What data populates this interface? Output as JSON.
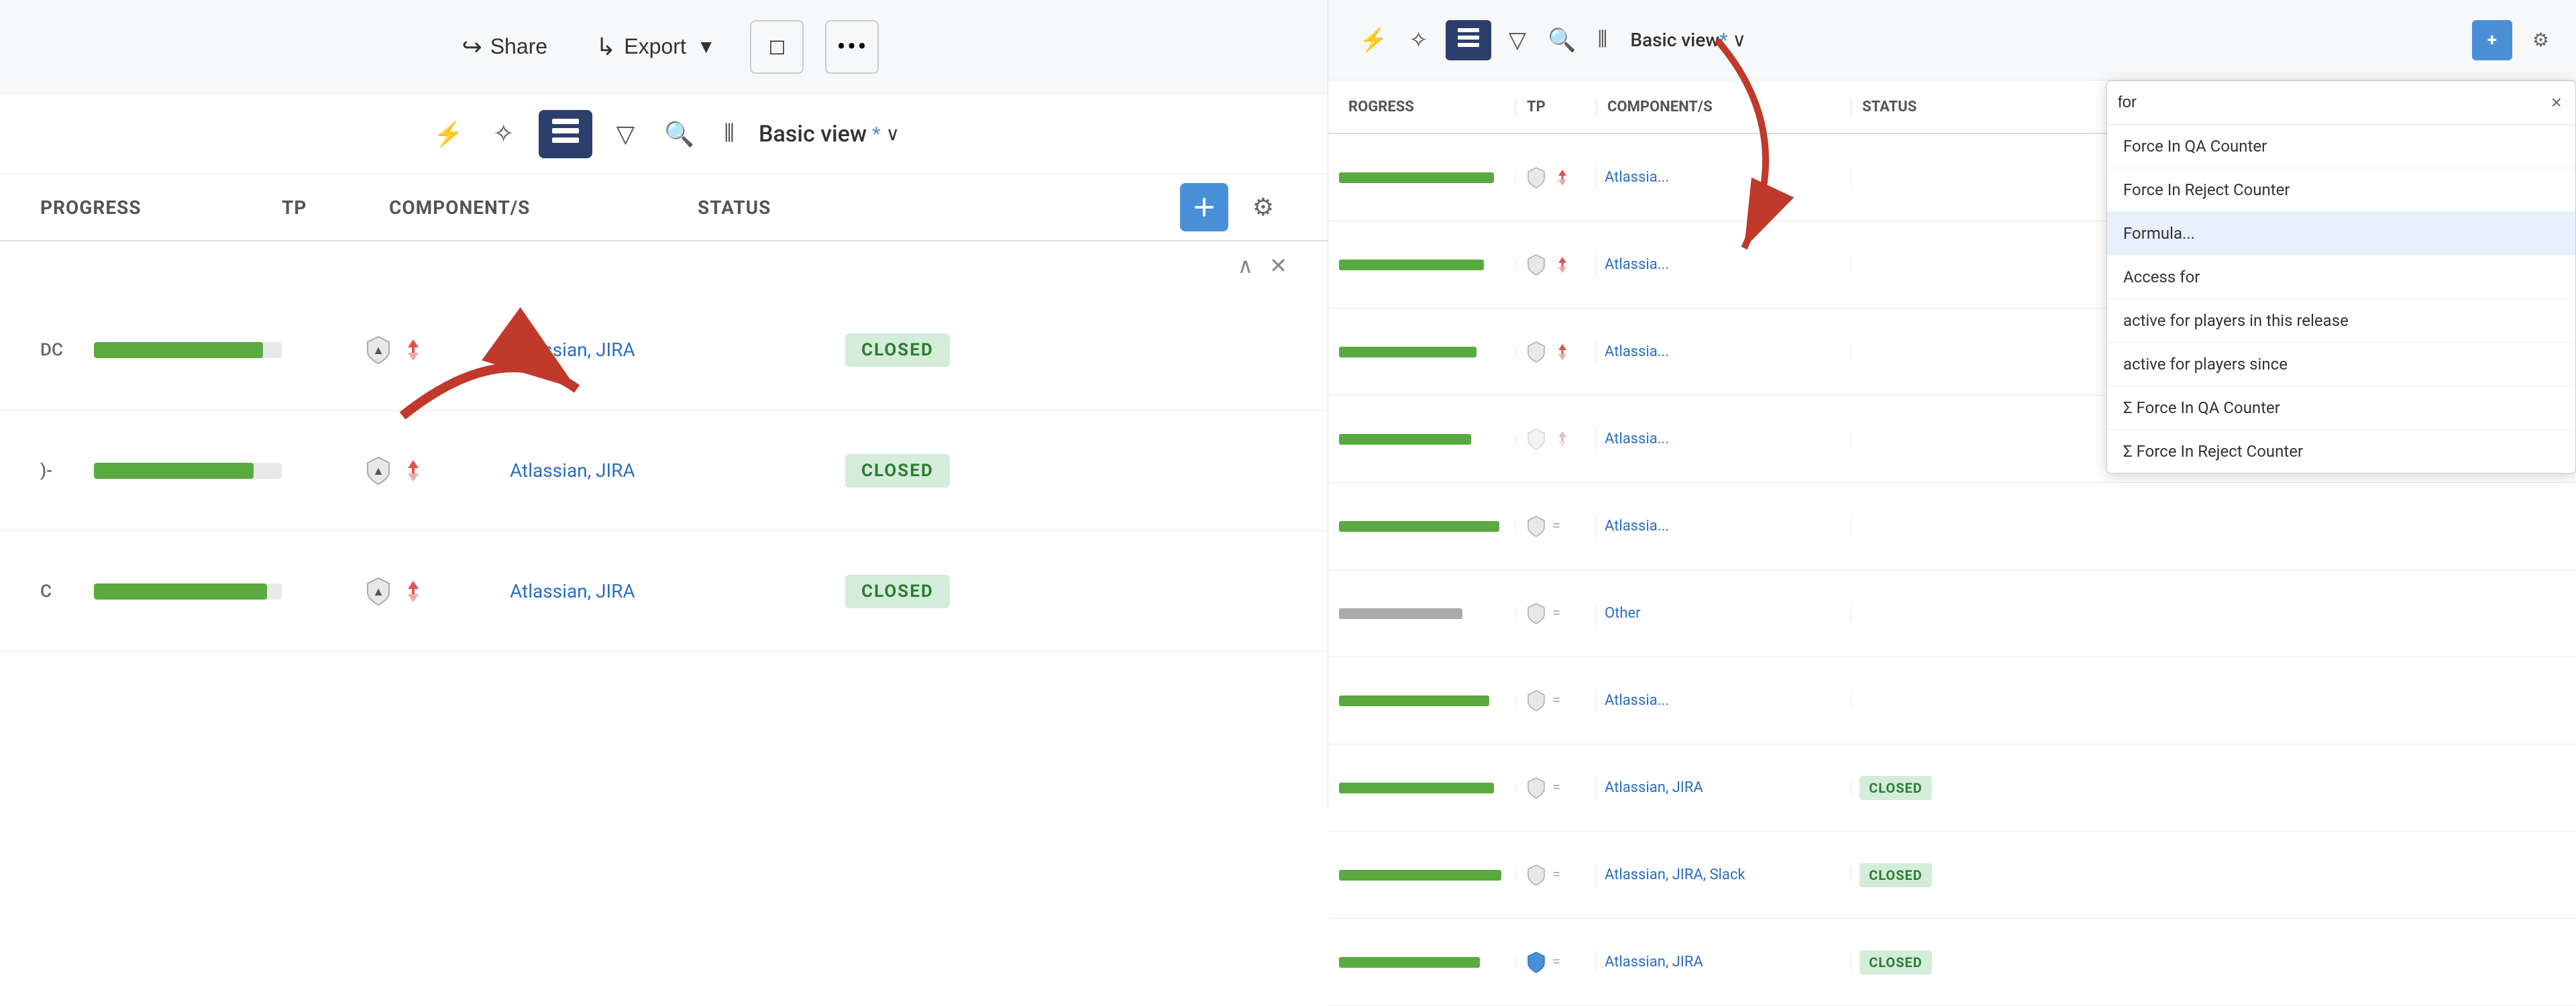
{
  "leftPanel": {
    "toolbar": {
      "shareLabel": "Share",
      "exportLabel": "Export",
      "shareIcon": "↪",
      "exportIcon": "↳"
    },
    "secondToolbar": {
      "lightningIcon": "⚡",
      "starIcon": "✧",
      "layersIcon": "≡",
      "filterIcon": "▽",
      "searchIcon": "⊙",
      "barsIcon": "|||",
      "basicViewLabel": "Basic view",
      "asterisk": "*",
      "chevronDown": "∨"
    },
    "columns": {
      "progress": "Progress",
      "tp": "TP",
      "component": "Component/s",
      "status": "Status"
    },
    "rows": [
      {
        "prefix": "DC",
        "progressPct": 90,
        "component": "Atlassian, JIRA",
        "status": "CLOSED"
      },
      {
        "prefix": ")-",
        "progressPct": 85,
        "component": "Atlassian, JIRA",
        "status": "CLOSED"
      },
      {
        "prefix": "C",
        "progressPct": 92,
        "component": "Atlassian, JIRA",
        "status": "CLOSED"
      }
    ]
  },
  "rightPanel": {
    "toolbar": {
      "lightningIcon": "⚡",
      "starIcon": "✧",
      "layersIcon": "≡",
      "filterIcon": "▽",
      "searchIcon": "⊙",
      "barsIcon": "|||",
      "basicViewLabel": "Basic view",
      "asterisk": "*",
      "chevronDown": "∨"
    },
    "columns": {
      "progress": "rogress",
      "tp": "TP",
      "component": "Component/s",
      "status": "Status"
    },
    "rows": [
      {
        "progressPct": 88,
        "component": "Atlassia",
        "status": ""
      },
      {
        "progressPct": 82,
        "component": "Atlassia",
        "status": ""
      },
      {
        "progressPct": 78,
        "component": "Atlassia",
        "status": ""
      },
      {
        "progressPct": 75,
        "component": "Atlassia",
        "status": ""
      },
      {
        "progressPct": 91,
        "component": "Atlassia",
        "status": ""
      },
      {
        "progressPct": 70,
        "component": "Other",
        "status": ""
      },
      {
        "progressPct": 85,
        "component": "Atlassia",
        "status": ""
      },
      {
        "progressPct": 88,
        "component": "Atlassian, JIRA",
        "status": "CLOSED"
      },
      {
        "progressPct": 92,
        "component": "Atlassian, JIRA, Slack",
        "status": "CLOSED"
      },
      {
        "progressPct": 80,
        "component": "Atlassian, JIRA",
        "status": "CLOSED"
      }
    ]
  },
  "dropdown": {
    "searchValue": "for",
    "closeBtnLabel": "×",
    "items": [
      {
        "label": "Force In QA Counter",
        "highlighted": false
      },
      {
        "label": "Force In Reject Counter",
        "highlighted": false
      },
      {
        "label": "Formula...",
        "highlighted": true
      },
      {
        "label": "Access for",
        "highlighted": false
      },
      {
        "label": "active for players in this release",
        "highlighted": false
      },
      {
        "label": "active for players since",
        "highlighted": false
      },
      {
        "label": "Σ Force In QA Counter",
        "highlighted": false
      },
      {
        "label": "Σ Force In Reject Counter",
        "highlighted": false
      }
    ]
  }
}
